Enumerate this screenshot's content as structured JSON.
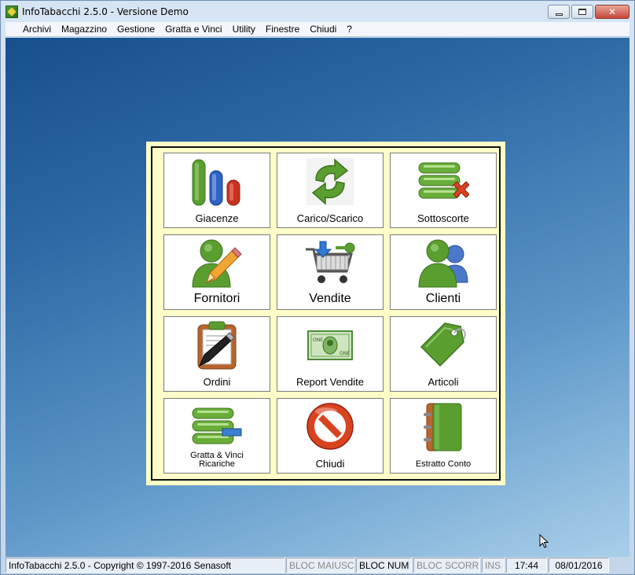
{
  "window": {
    "title": "InfoTabacchi 2.5.0 - Versione Demo",
    "controls": {
      "minimize": "minimize",
      "maximize": "maximize",
      "close": "close"
    }
  },
  "menu": [
    "Archivi",
    "Magazzino",
    "Gestione",
    "Gratta e Vinci",
    "Utility",
    "Finestre",
    "Chiudi",
    "?"
  ],
  "tiles": [
    {
      "label": "Giacenze",
      "icon": "bar-chart-icon",
      "size": "normal"
    },
    {
      "label": "Carico/Scarico",
      "icon": "recycle-arrows-icon",
      "size": "normal"
    },
    {
      "label": "Sottoscorte",
      "icon": "database-delete-icon",
      "size": "normal"
    },
    {
      "label": "Fornitori",
      "icon": "user-edit-icon",
      "size": "big"
    },
    {
      "label": "Vendite",
      "icon": "shopping-cart-icon",
      "size": "big"
    },
    {
      "label": "Clienti",
      "icon": "users-icon",
      "size": "big"
    },
    {
      "label": "Ordini",
      "icon": "clipboard-pen-icon",
      "size": "normal"
    },
    {
      "label": "Report Vendite",
      "icon": "banknote-icon",
      "size": "normal"
    },
    {
      "label": "Articoli",
      "icon": "price-tag-icon",
      "size": "normal"
    },
    {
      "label": "Gratta & Vinci\nRicariche",
      "icon": "database-card-icon",
      "size": "small"
    },
    {
      "label": "Chiudi",
      "icon": "no-entry-icon",
      "size": "normal"
    },
    {
      "label": "Estratto Conto",
      "icon": "address-book-icon",
      "size": "small"
    }
  ],
  "status": {
    "app": "InfoTabacchi 2.5.0 - Copyright © 1997-2016 Senasoft",
    "caps": "BLOC MAIUSC",
    "num": "BLOC NUM",
    "scroll": "BLOC SCORR",
    "ins": "INS",
    "time": "17:44",
    "date": "08/01/2016"
  },
  "colors": {
    "panel_bg": "#fffec8",
    "desktop_top": "#184f8d",
    "desktop_bottom": "#a9cfea",
    "icon_green": "#5a9e2f",
    "icon_blue": "#2e63c4",
    "icon_red": "#c8321f"
  }
}
